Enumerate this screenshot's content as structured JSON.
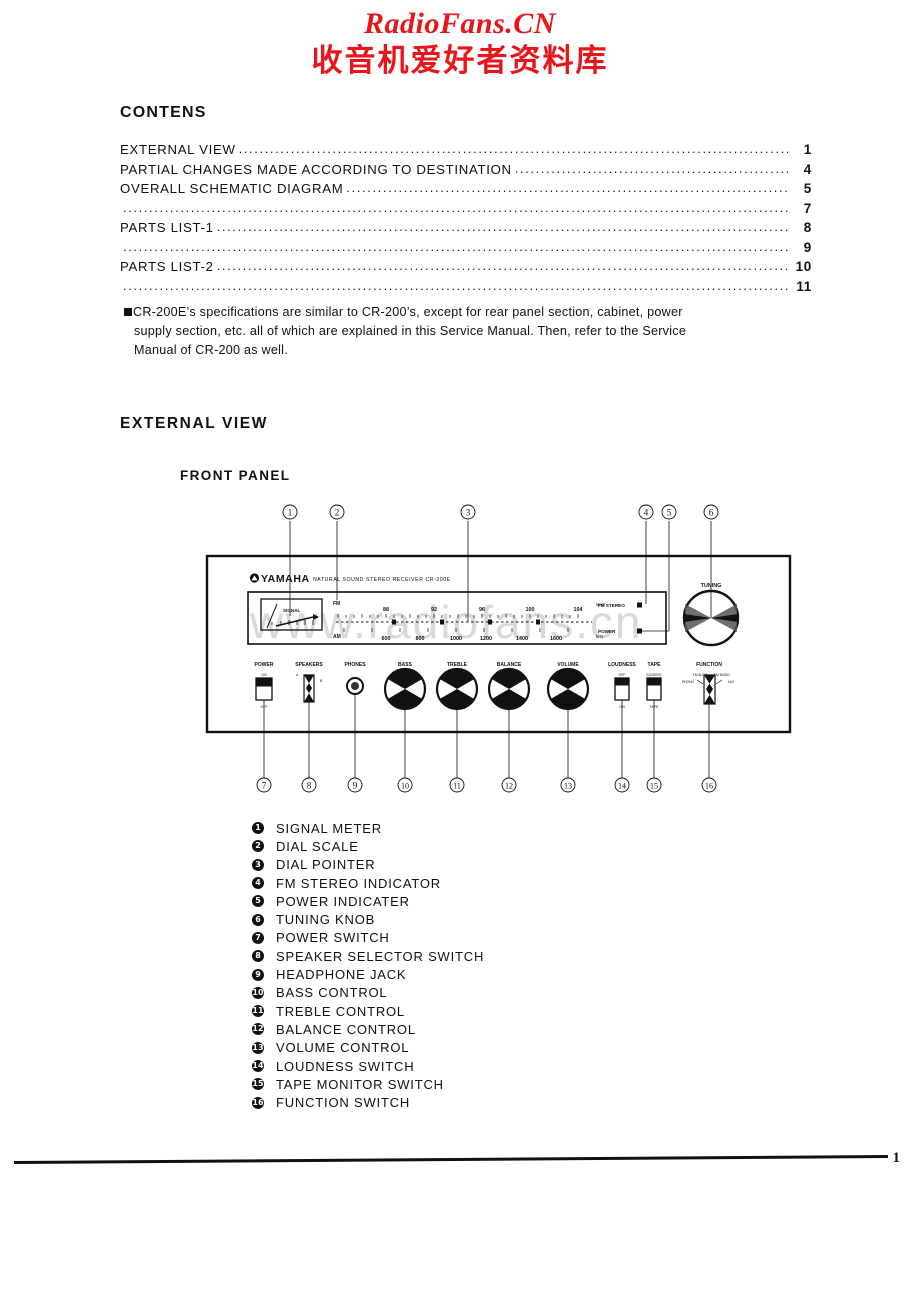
{
  "watermark": {
    "latin": "RadioFans.CN",
    "cjk": "收音机爱好者资料库",
    "color": "#e8161b",
    "panel_overlay": "www.radiofans.cn"
  },
  "contents": {
    "title": "CONTENS",
    "rows": [
      {
        "label": "EXTERNAL VIEW",
        "page": "1"
      },
      {
        "label": "PARTIAL CHANGES MADE ACCORDING TO DESTINATION",
        "page": "4"
      },
      {
        "label": "OVERALL SCHEMATIC DIAGRAM",
        "page": "5"
      },
      {
        "label": "",
        "page": "7"
      },
      {
        "label": "PARTS LIST-1",
        "page": "8"
      },
      {
        "label": "",
        "page": "9"
      },
      {
        "label": "PARTS LIST-2",
        "page": "10"
      },
      {
        "label": "",
        "page": "11"
      }
    ]
  },
  "note": {
    "line1": "CR-200E’s specifications are similar to CR-200’s, except for rear panel section, cabinet, power",
    "line2": "supply section, etc. all of which are explained in this Service Manual. Then, refer to the Service",
    "line3": "Manual of CR-200 as well."
  },
  "headings": {
    "external_view": "EXTERNAL VIEW",
    "front_panel": "FRONT PANEL"
  },
  "panel": {
    "brand": "YAMAHA",
    "model_line": "NATURAL SOUND STEREO RECEIVER CR-200E",
    "meter_label": "SIGNAL",
    "band_fm": "FM",
    "band_am": "AM",
    "unit_mhz": "MHz",
    "unit_khz": "kHz",
    "fm_ticks": [
      "88",
      "92",
      "96",
      "100",
      "104",
      "108"
    ],
    "am_ticks": [
      "600",
      "800",
      "1000",
      "1200",
      "1400",
      "1600"
    ],
    "indicator_fm_stereo": "FM STEREO",
    "indicator_power": "POWER",
    "tuning_label": "TUNING",
    "controls": [
      "POWER",
      "SPEAKERS",
      "PHONES",
      "BASS",
      "TREBLE",
      "BALANCE",
      "VOLUME",
      "LOUDNESS",
      "TAPE",
      "FUNCTION"
    ],
    "power_states": [
      "ON",
      "OFF"
    ],
    "speaker_states": [
      "A",
      "B"
    ],
    "loudness_states": [
      "OFF",
      "ON"
    ],
    "tape_states": [
      "SOURCE",
      "TAPE"
    ],
    "function_states": [
      "PHONO",
      "FM AUTO",
      "FM MONO",
      "AUX",
      "AM"
    ],
    "callouts_top": [
      "1",
      "2",
      "3",
      "4",
      "5",
      "6"
    ],
    "callouts_bottom": [
      "7",
      "8",
      "9",
      "10",
      "11",
      "12",
      "13",
      "14",
      "15",
      "16"
    ]
  },
  "legend": {
    "items": [
      {
        "num": "1",
        "label": "SIGNAL METER"
      },
      {
        "num": "2",
        "label": "DIAL SCALE"
      },
      {
        "num": "3",
        "label": "DIAL POINTER"
      },
      {
        "num": "4",
        "label": "FM STEREO INDICATOR"
      },
      {
        "num": "5",
        "label": "POWER INDICATER"
      },
      {
        "num": "6",
        "label": "TUNING KNOB"
      },
      {
        "num": "7",
        "label": "POWER SWITCH"
      },
      {
        "num": "8",
        "label": "SPEAKER SELECTOR SWITCH"
      },
      {
        "num": "9",
        "label": "HEADPHONE JACK"
      },
      {
        "num": "10",
        "label": "BASS CONTROL"
      },
      {
        "num": "11",
        "label": "TREBLE CONTROL"
      },
      {
        "num": "12",
        "label": "BALANCE CONTROL"
      },
      {
        "num": "13",
        "label": "VOLUME CONTROL"
      },
      {
        "num": "14",
        "label": "LOUDNESS SWITCH"
      },
      {
        "num": "15",
        "label": "TAPE MONITOR SWITCH"
      },
      {
        "num": "16",
        "label": "FUNCTION SWITCH"
      }
    ]
  },
  "footer": {
    "page_number": "1"
  }
}
